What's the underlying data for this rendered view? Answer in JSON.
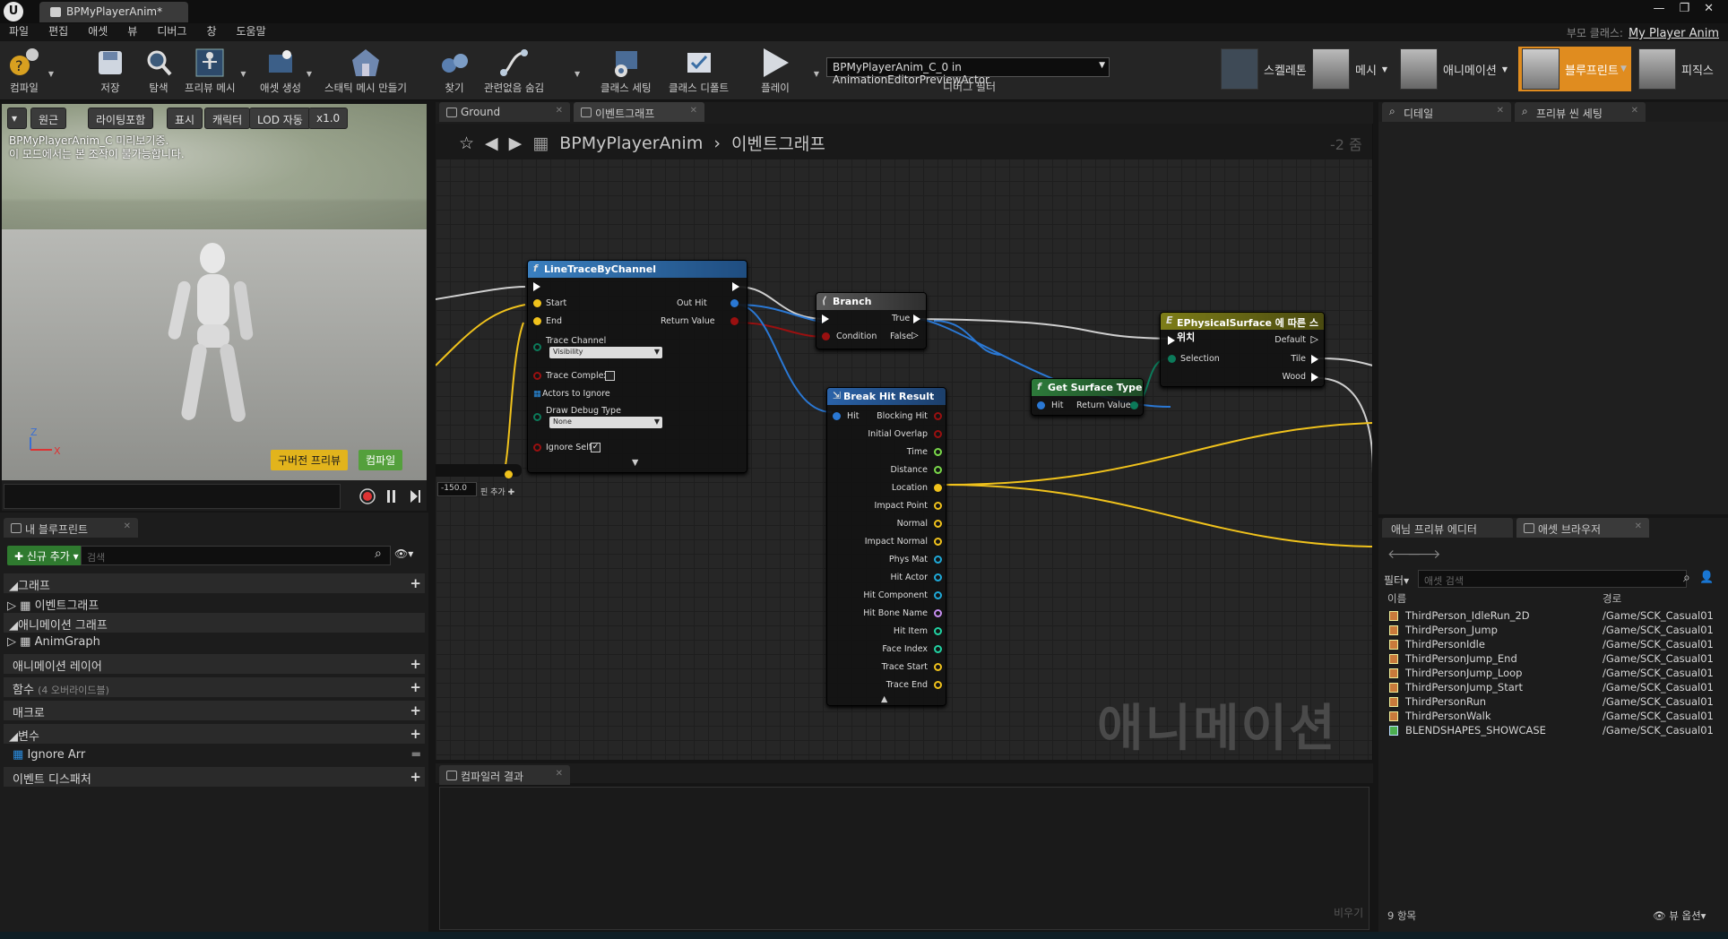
{
  "window": {
    "tab_title": "BPMyPlayerAnim*",
    "logo": "U",
    "controls": [
      "—",
      "❐",
      "✕"
    ],
    "parent_class_label": "부모 클래스:",
    "parent_class_value": "My Player Anim"
  },
  "menu": [
    "파일",
    "편집",
    "애셋",
    "뷰",
    "디버그",
    "창",
    "도움말"
  ],
  "toolbar": {
    "compile": "컴파일",
    "save": "저장",
    "browse": "탐색",
    "preview_mesh": "프리뷰 메시",
    "create_asset": "애셋 생성",
    "make_static_mesh": "스태틱 메시 만들기",
    "find": "찾기",
    "hide_unrelated": "관련없음 숨김",
    "class_settings": "클래스 세팅",
    "class_defaults": "클래스 디폴트",
    "play": "플레이",
    "debug_object": "BPMyPlayerAnim_C_0 in AnimationEditorPreviewActor",
    "debug_filter": "디버그 필터"
  },
  "modes": [
    "스켈레톤",
    "메시",
    "애니메이션",
    "블루프린트",
    "피직스"
  ],
  "viewport": {
    "buttons": [
      "원근",
      "라이팅포함",
      "표시",
      "캐릭터",
      "LOD 자동",
      "x1.0"
    ],
    "note_line1": "BPMyPlayerAnim_C 미리보기중.",
    "note_line2": "이 모드에서는 본 조작이 불가능합니다.",
    "preview_badge": "구버전 프리뷰",
    "compile_badge": "컴파일",
    "axis_z": "Z",
    "axis_x": "X"
  },
  "my_blueprint": {
    "tab": "내 블루프린트",
    "add_new": "신규 추가",
    "search_placeholder": "검색",
    "graphs": "그래프",
    "event_graph": "이벤트그래프",
    "anim_graphs": "애니메이션 그래프",
    "anim_graph": "AnimGraph",
    "anim_layers": "애니메이션 레이어",
    "functions": "함수",
    "functions_override": "(4 오버라이드블)",
    "macros": "매크로",
    "variables": "변수",
    "var_ignore_arr": "Ignore Arr",
    "event_dispatchers": "이벤트 디스패처"
  },
  "graph_tabs": [
    "Ground",
    "이벤트그래프"
  ],
  "graph": {
    "breadcrumb_root": "BPMyPlayerAnim",
    "breadcrumb_leaf": "이벤트그래프",
    "zoom": "-2 줌",
    "watermark": "애니메이션",
    "value_box": "-150.0",
    "add_pin": "핀 추가",
    "nodes": {
      "line_trace": {
        "title": "LineTraceByChannel",
        "pins": [
          "Start",
          "End",
          "Trace Channel",
          "Trace Complex",
          "Actors to Ignore",
          "Draw Debug Type",
          "Ignore Self"
        ],
        "out_pins": [
          "Out Hit",
          "Return Value"
        ],
        "trace_channel_value": "Visibility",
        "draw_debug_value": "None"
      },
      "branch": {
        "title": "Branch",
        "condition": "Condition",
        "true": "True",
        "false": "False"
      },
      "break_hit": {
        "title": "Break Hit Result",
        "input": "Hit",
        "outputs": [
          "Blocking Hit",
          "Initial Overlap",
          "Time",
          "Distance",
          "Location",
          "Impact Point",
          "Normal",
          "Impact Normal",
          "Phys Mat",
          "Hit Actor",
          "Hit Component",
          "Hit Bone Name",
          "Hit Item",
          "Face Index",
          "Trace Start",
          "Trace End"
        ]
      },
      "surface_type": {
        "title": "Get Surface Type",
        "input": "Hit",
        "output": "Return Value"
      },
      "switch": {
        "title": "EPhysicalSurface 에 따른 스위치",
        "selection": "Selection",
        "outputs": [
          "Default",
          "Tile",
          "Wood"
        ]
      }
    }
  },
  "compiler": {
    "tab": "컴파일러 결과",
    "clear": "비우기"
  },
  "details": {
    "tabs": [
      "디테일",
      "프리뷰 씬 세팅"
    ]
  },
  "asset_browser": {
    "tabs": [
      "애님 프리뷰 에디터",
      "애셋 브라우저"
    ],
    "filter": "필터",
    "search_placeholder": "애셋 검색",
    "col_name": "이름",
    "col_path": "경로",
    "rows": [
      {
        "name": "ThirdPerson_IdleRun_2D",
        "path": "/Game/SCK_Casual01"
      },
      {
        "name": "ThirdPerson_Jump",
        "path": "/Game/SCK_Casual01"
      },
      {
        "name": "ThirdPersonIdle",
        "path": "/Game/SCK_Casual01"
      },
      {
        "name": "ThirdPersonJump_End",
        "path": "/Game/SCK_Casual01"
      },
      {
        "name": "ThirdPersonJump_Loop",
        "path": "/Game/SCK_Casual01"
      },
      {
        "name": "ThirdPersonJump_Start",
        "path": "/Game/SCK_Casual01"
      },
      {
        "name": "ThirdPersonRun",
        "path": "/Game/SCK_Casual01"
      },
      {
        "name": "ThirdPersonWalk",
        "path": "/Game/SCK_Casual01"
      },
      {
        "name": "BLENDSHAPES_SHOWCASE",
        "path": "/Game/SCK_Casual01"
      }
    ],
    "count": "9 항목",
    "view_options": "뷰 옵션"
  },
  "colors": {
    "accent": "#e08c1f",
    "exec": "#ffffff",
    "struct_pin": "#2a78d4",
    "bool_pin": "#9a1010",
    "vector_pin": "#f0c21c",
    "float_pin": "#7ad84a",
    "object_pin": "#1fa9d8",
    "name_pin": "#c68ef0",
    "int_pin": "#21d3a3",
    "enum_pin": "#0c7a5a"
  }
}
